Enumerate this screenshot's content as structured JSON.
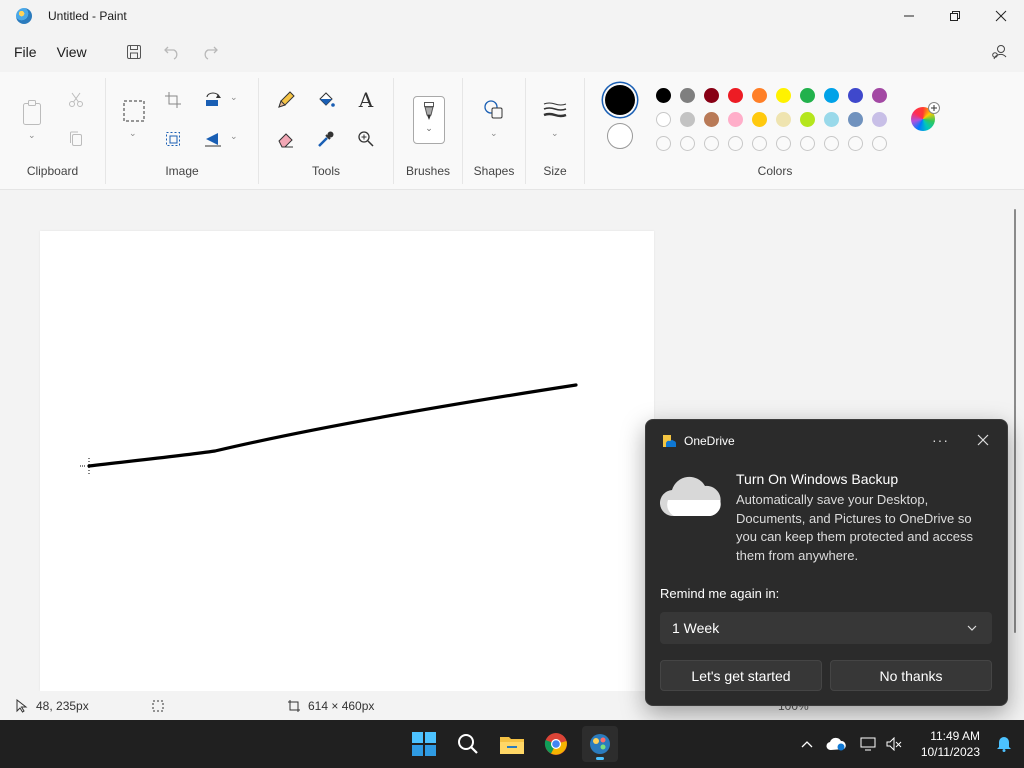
{
  "window": {
    "title": "Untitled - Paint"
  },
  "menu": {
    "file": "File",
    "view": "View"
  },
  "ribbon": {
    "groups": {
      "clipboard": "Clipboard",
      "image": "Image",
      "tools": "Tools",
      "brushes": "Brushes",
      "shapes": "Shapes",
      "size": "Size",
      "colors": "Colors"
    },
    "colors": {
      "primary": "#000000",
      "secondary": "#ffffff",
      "row1": [
        "#000000",
        "#7f7f7f",
        "#880015",
        "#ed1c24",
        "#ff7f27",
        "#fff200",
        "#22b14c",
        "#00a2e8",
        "#3f48cc",
        "#a349a4"
      ],
      "row2": [
        "#ffffff",
        "#c3c3c3",
        "#b97a57",
        "#ffaec9",
        "#ffc90e",
        "#efe4b0",
        "#b5e61d",
        "#99d9ea",
        "#7092be",
        "#c8bfe7"
      ]
    }
  },
  "status": {
    "cursor": "48, 235px",
    "canvas_size": "614 × 460px",
    "zoom": "100%"
  },
  "toast": {
    "app": "OneDrive",
    "title": "Turn On Windows Backup",
    "body": "Automatically save your Desktop, Documents, and Pictures to OneDrive so you can keep them protected and access them from anywhere.",
    "remind_label": "Remind me again in:",
    "remind_value": "1 Week",
    "primary_button": "Let's get started",
    "secondary_button": "No thanks"
  },
  "taskbar": {
    "time": "11:49 AM",
    "date": "10/11/2023"
  }
}
